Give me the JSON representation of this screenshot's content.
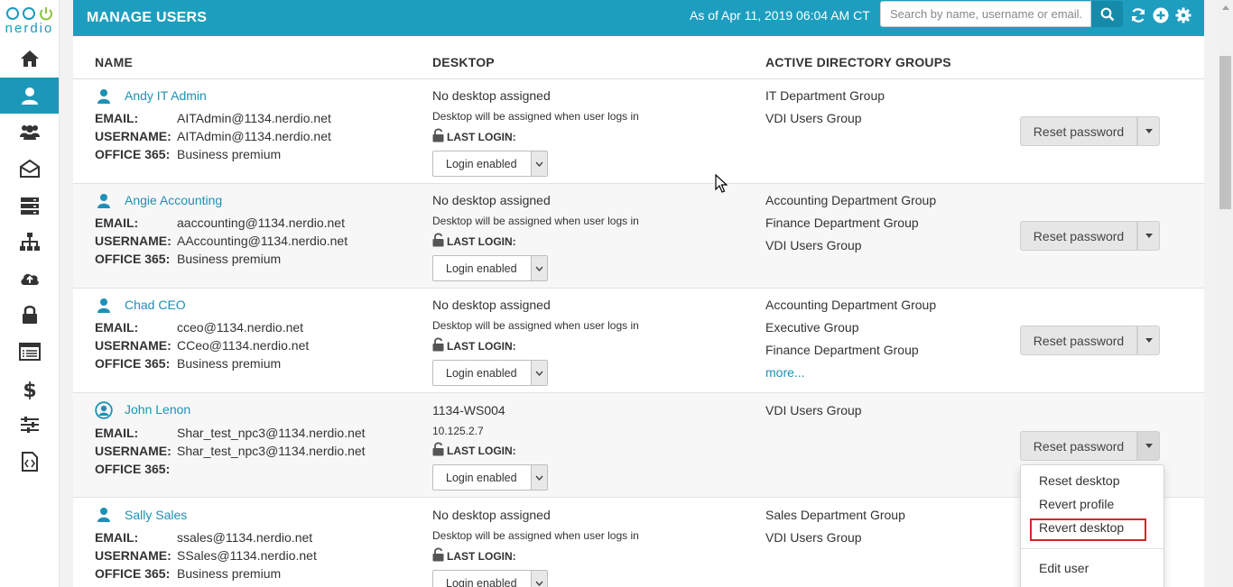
{
  "app": {
    "logo_text": "nerdio"
  },
  "sidebar": {
    "items": [
      {
        "icon": "home-icon",
        "active": false
      },
      {
        "icon": "user-icon",
        "active": true
      },
      {
        "icon": "users-group-icon",
        "active": false
      },
      {
        "icon": "envelope-open-icon",
        "active": false
      },
      {
        "icon": "server-icon",
        "active": false
      },
      {
        "icon": "sitemap-icon",
        "active": false
      },
      {
        "icon": "cloud-upload-icon",
        "active": false
      },
      {
        "icon": "lock-icon",
        "active": false
      },
      {
        "icon": "list-icon",
        "active": false
      },
      {
        "icon": "dollar-icon",
        "active": false
      },
      {
        "icon": "sliders-icon",
        "active": false
      },
      {
        "icon": "code-file-icon",
        "active": false
      }
    ]
  },
  "header": {
    "title": "MANAGE USERS",
    "as_of": "As of Apr 11, 2019 06:04 AM CT",
    "search_placeholder": "Search by name, username or email...",
    "icons": [
      "search-icon",
      "refresh-icon",
      "add-icon",
      "gear-icon"
    ]
  },
  "table": {
    "headers": {
      "name": "NAME",
      "desktop": "DESKTOP",
      "ad_groups": "ACTIVE DIRECTORY GROUPS"
    },
    "labels": {
      "email": "EMAIL:",
      "username": "USERNAME:",
      "office": "OFFICE 365:",
      "last_login": "LAST LOGIN:"
    },
    "select_value": "Login enabled",
    "reset_label": "Reset password",
    "rows": [
      {
        "name": "Andy IT Admin",
        "icon": "user-icon",
        "email": "AITAdmin@1134.nerdio.net",
        "username": "AITAdmin@1134.nerdio.net",
        "office": "Business premium",
        "desktop": "No desktop assigned",
        "desktop_sub": "Desktop will be assigned when user logs in",
        "groups": [
          "IT Department Group",
          "VDI Users Group"
        ],
        "more": ""
      },
      {
        "name": "Angie Accounting",
        "icon": "user-icon",
        "email": "aaccounting@1134.nerdio.net",
        "username": "AAccounting@1134.nerdio.net",
        "office": "Business premium",
        "desktop": "No desktop assigned",
        "desktop_sub": "Desktop will be assigned when user logs in",
        "groups": [
          "Accounting Department Group",
          "Finance Department Group",
          "VDI Users Group"
        ],
        "more": ""
      },
      {
        "name": "Chad CEO",
        "icon": "user-icon",
        "email": "cceo@1134.nerdio.net",
        "username": "CCeo@1134.nerdio.net",
        "office": "Business premium",
        "desktop": "No desktop assigned",
        "desktop_sub": "Desktop will be assigned when user logs in",
        "groups": [
          "Accounting Department Group",
          "Executive Group",
          "Finance Department Group"
        ],
        "more": "more..."
      },
      {
        "name": "John Lenon",
        "icon": "user-circle-icon",
        "email": "Shar_test_npc3@1134.nerdio.net",
        "username": "Shar_test_npc3@1134.nerdio.net",
        "office": "",
        "desktop": "1134-WS004",
        "desktop_sub": "10.125.2.7",
        "groups": [
          "VDI Users Group"
        ],
        "more": ""
      },
      {
        "name": "Sally Sales",
        "icon": "user-icon",
        "email": "ssales@1134.nerdio.net",
        "username": "SSales@1134.nerdio.net",
        "office": "Business premium",
        "desktop": "No desktop assigned",
        "desktop_sub": "Desktop will be assigned when user logs in",
        "groups": [
          "Sales Department Group",
          "VDI Users Group"
        ],
        "more": ""
      }
    ]
  },
  "dropdown_menu": {
    "items": [
      "Reset desktop",
      "Revert profile",
      "Revert desktop",
      "Edit user"
    ],
    "highlighted": "Revert desktop"
  },
  "colors": {
    "accent": "#1e9ebf",
    "link": "#1e90b5",
    "highlight_box": "#d9232d"
  }
}
